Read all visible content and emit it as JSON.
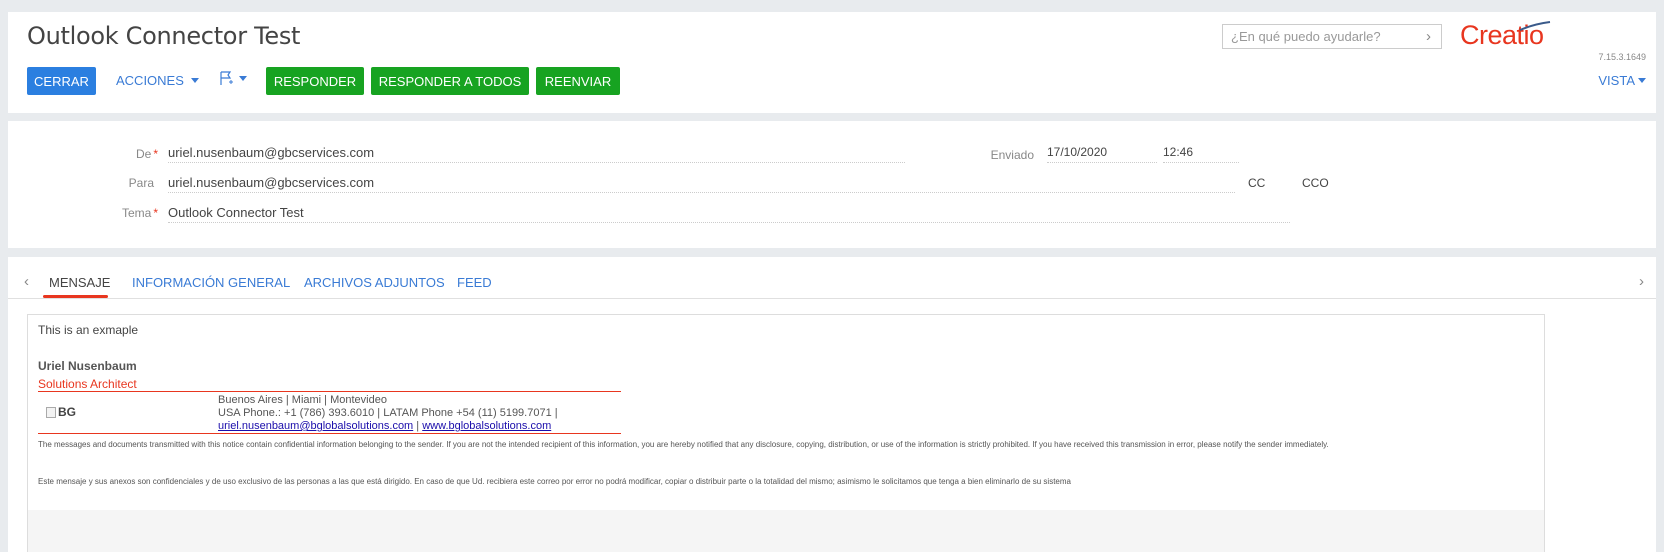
{
  "header": {
    "title": "Outlook Connector Test",
    "buttons": {
      "close": "CERRAR",
      "actions": "ACCIONES",
      "respond": "RESPONDER",
      "respond_all": "RESPONDER A TODOS",
      "forward": "REENVIAR"
    },
    "search_placeholder": "¿En qué puedo ayudarle?",
    "logo": "Creatio",
    "version": "7.15.3.1649",
    "view": "VISTA"
  },
  "fields": {
    "from_label": "De",
    "from_value": "uriel.nusenbaum@gbcservices.com",
    "to_label": "Para",
    "to_value": "uriel.nusenbaum@gbcservices.com",
    "subject_label": "Tema",
    "subject_value": "Outlook Connector Test",
    "sent_label": "Enviado",
    "sent_date": "17/10/2020",
    "sent_time": "12:46",
    "cc_label": "CC",
    "bcc_label": "CCO"
  },
  "tabs": [
    {
      "label": "MENSAJE",
      "active": true
    },
    {
      "label": "INFORMACIÓN GENERAL",
      "active": false
    },
    {
      "label": "ARCHIVOS ADJUNTOS",
      "active": false
    },
    {
      "label": "FEED",
      "active": false
    }
  ],
  "message": {
    "body": "This is an exmaple",
    "sig_name": "Uriel Nusenbaum",
    "sig_title": "Solutions Architect",
    "sig_image_alt": "BG",
    "sig_cities": "Buenos Aires | Miami | Montevideo",
    "sig_phones": "USA Phone.: +1 (786) 393.6010 | LATAM Phone +54 (11) 5199.7071 |",
    "sig_email": "uriel.nusenbaum@bglobalsolutions.com",
    "sig_separator": " | ",
    "sig_web": "www.bglobalsolutions.com",
    "disclaimer_en": "The messages and documents transmitted with this notice contain confidential information belonging to the sender. If you are not the intended recipient of this information, you are hereby notified that any disclosure, copying, distribution, or use of the information is strictly prohibited. If you have received this transmission in error, please notify the sender immediately.",
    "disclaimer_es": "Este mensaje y sus anexos son confidenciales y de uso exclusivo de las personas a las que está dirigido. En caso de que Ud. recibiera este correo por error no podrá modificar, copiar o distribuir parte o la totalidad del mismo; asimismo le solicitamos que tenga a bien eliminarlo de su sistema"
  },
  "colors": {
    "accent_blue": "#2b7fe0",
    "action_green": "#17a321",
    "brand_red": "#e8361f"
  }
}
